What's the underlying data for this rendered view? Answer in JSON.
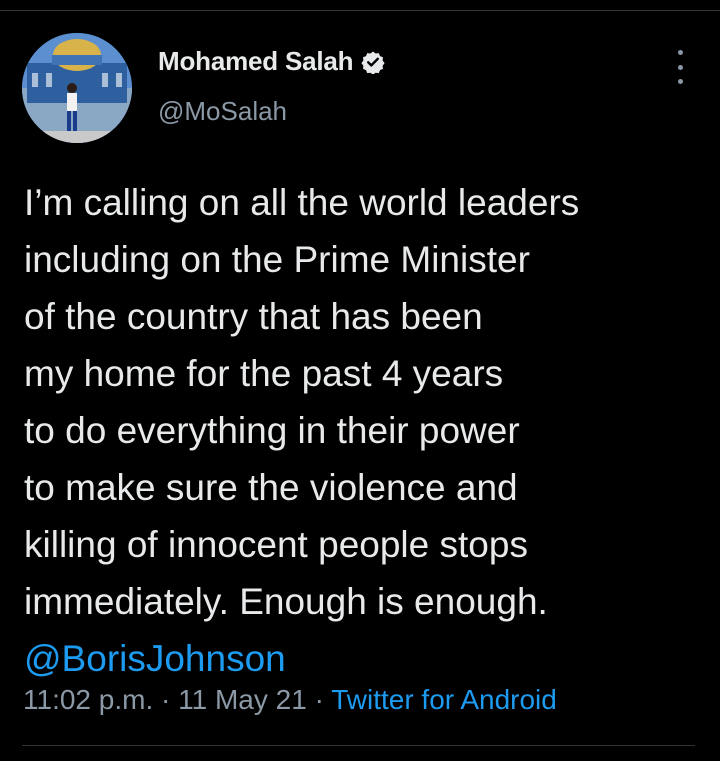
{
  "tweet": {
    "author": {
      "display_name": "Mohamed Salah",
      "handle": "@MoSalah",
      "verified": true
    },
    "text_lines": [
      "I’m calling on all the world leaders",
      "including on the Prime Minister",
      "of the country that has been",
      "my home for the past 4 years",
      "to do everything in their power",
      "to make sure the violence and",
      "killing of innocent people stops",
      "immediately. Enough is enough."
    ],
    "mention": "@BorisJohnson",
    "time": "11:02 p.m.",
    "separator": " · ",
    "date": "11 May 21",
    "source": "Twitter for Android"
  },
  "icons": {
    "verified": "verified-badge-icon",
    "more": "more-options-icon"
  },
  "colors": {
    "background": "#000000",
    "text": "#e7e9ea",
    "secondary": "#8b98a5",
    "link": "#1d9bf0"
  }
}
